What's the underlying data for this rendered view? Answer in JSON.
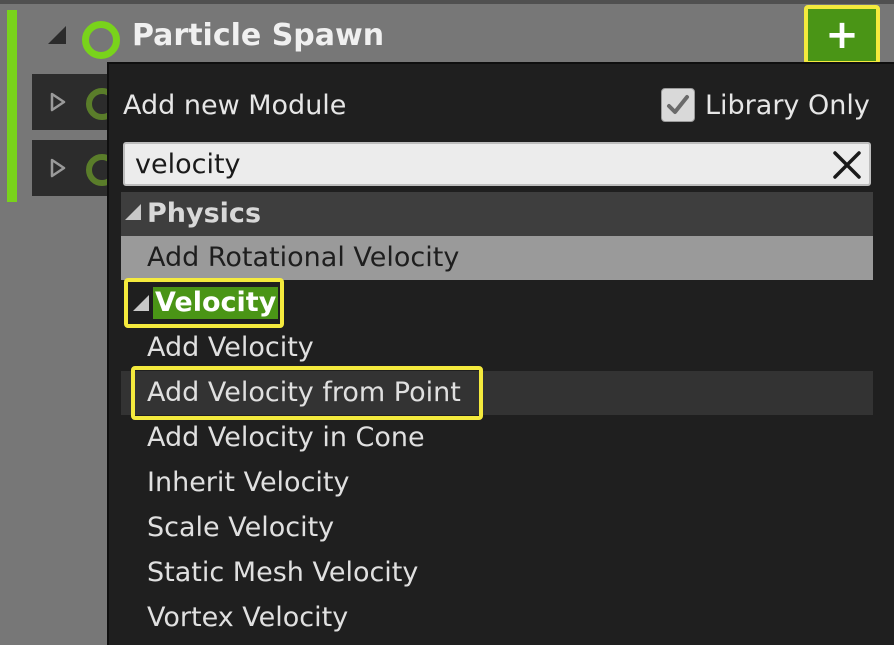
{
  "header": {
    "title": "Particle Spawn",
    "add_button_label": "+"
  },
  "dropdown": {
    "title": "Add new Module",
    "library_only": {
      "label": "Library Only",
      "checked": true
    },
    "search": {
      "value": "velocity"
    },
    "categories": [
      {
        "label": "Physics",
        "items": [
          "Add Rotational Velocity"
        ]
      },
      {
        "label": "Velocity",
        "items": [
          "Add Velocity",
          "Add Velocity from Point",
          "Add Velocity in Cone",
          "Inherit Velocity",
          "Scale Velocity",
          "Static Mesh Velocity",
          "Vortex Velocity"
        ]
      }
    ]
  },
  "colors": {
    "accent_green": "#79d31b",
    "button_green": "#4a9516",
    "highlight_yellow": "#f4ea3d"
  }
}
